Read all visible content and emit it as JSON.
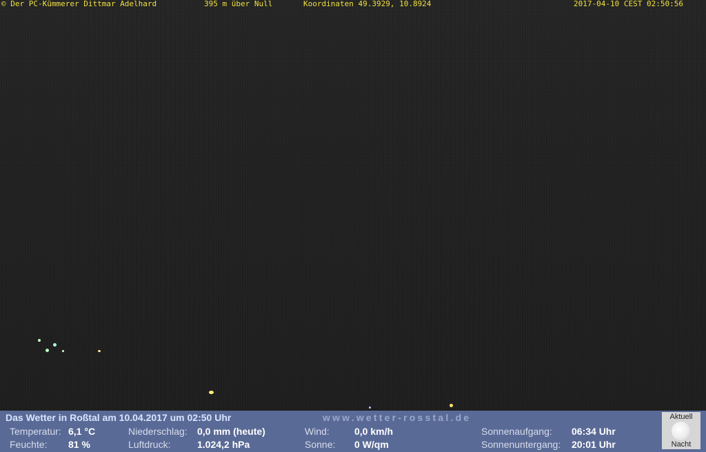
{
  "overlay": {
    "copyright": "© Der PC-Kümmerer Dittmar Adelhard",
    "altitude": "395 m über Null",
    "coordinates": "Koordinaten 49.3929, 10.8924",
    "timestamp": "2017-04-10 CEST 02:50:56"
  },
  "weather": {
    "title": "Das Wetter in Roßtal am 10.04.2017 um 02:50 Uhr",
    "url": "www.wetter-rosstal.de",
    "temperature": {
      "label": "Temperatur:",
      "value": "6,1 °C"
    },
    "humidity": {
      "label": "Feuchte:",
      "value": "81 %"
    },
    "precipitation": {
      "label": "Niederschlag:",
      "value": "0,0 mm (heute)"
    },
    "pressure": {
      "label": "Luftdruck:",
      "value": "1.024,2 hPa"
    },
    "wind": {
      "label": "Wind:",
      "value": "0,0 km/h"
    },
    "sun": {
      "label": "Sonne:",
      "value": "0 W/qm"
    },
    "sunrise": {
      "label": "Sonnenaufgang:",
      "value": "06:34 Uhr"
    },
    "sunset": {
      "label": "Sonnenuntergang:",
      "value": "20:01 Uhr"
    },
    "moon": {
      "top_label": "Aktuell",
      "bottom_label": "Nacht",
      "icon": "moon-icon"
    }
  },
  "colors": {
    "overlay_text": "#f0e040",
    "panel_background": "#5a6a96",
    "title_text": "#d8e4ff"
  }
}
